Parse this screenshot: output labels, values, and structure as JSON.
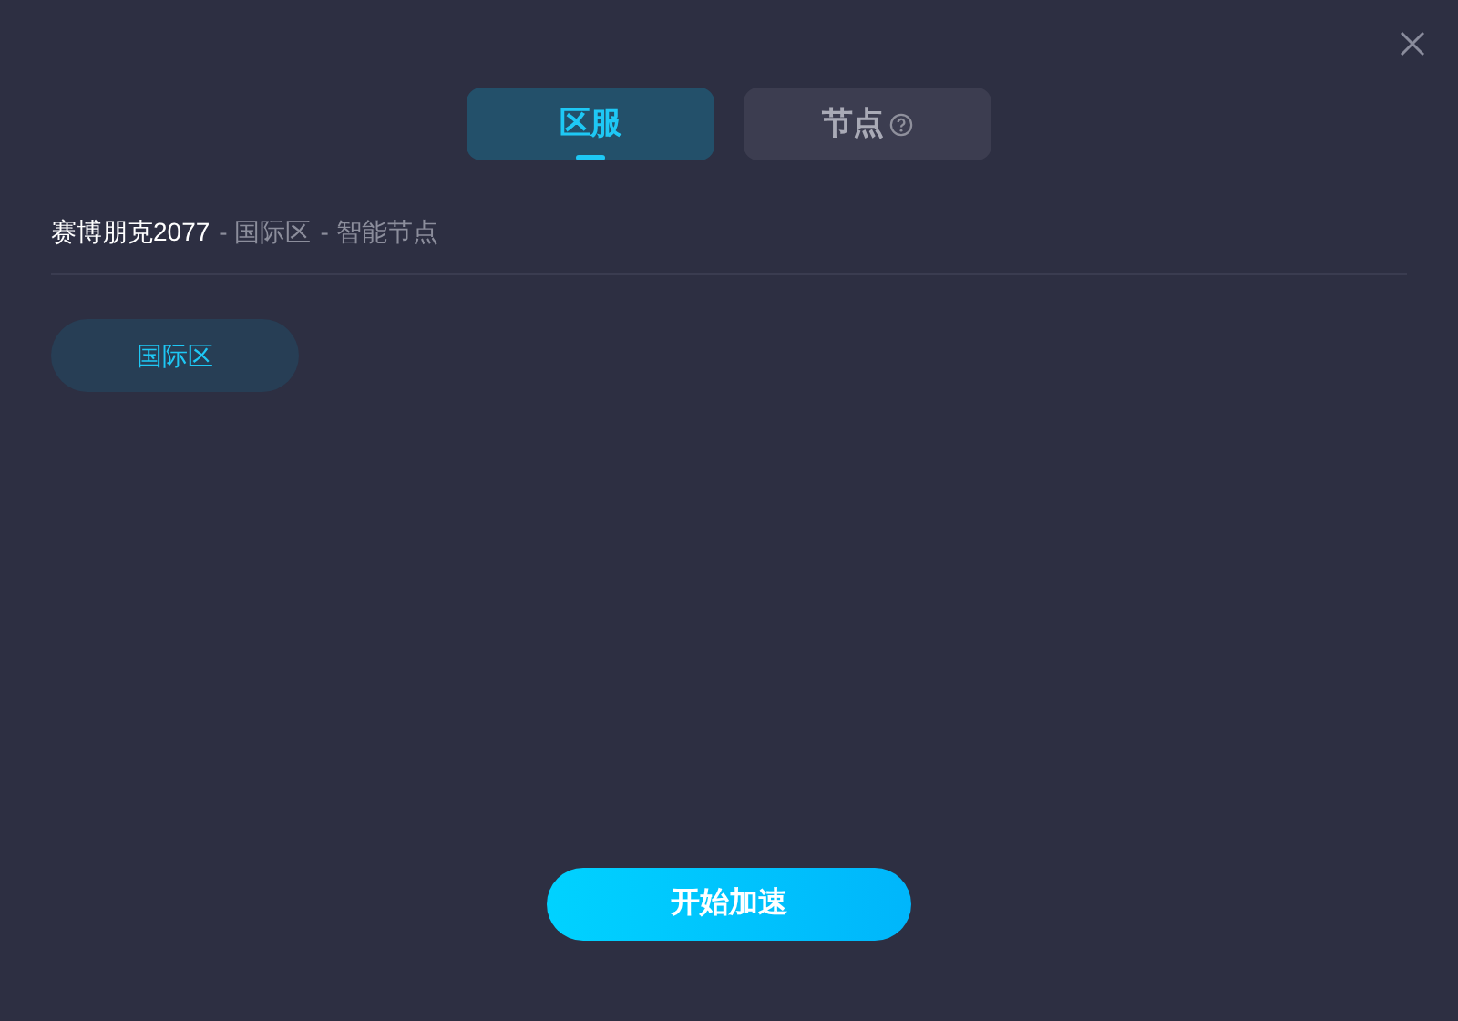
{
  "tabs": [
    {
      "label": "区服",
      "selected": true,
      "help": false
    },
    {
      "label": "节点",
      "selected": false,
      "help": true
    }
  ],
  "breadcrumb": [
    {
      "text": "赛博朋克2077",
      "kind": "title"
    },
    {
      "text": "- 国际区",
      "kind": "crumb"
    },
    {
      "text": "- 智能节点",
      "kind": "crumb"
    }
  ],
  "regions": [
    {
      "label": "国际区",
      "selected": true
    }
  ],
  "start_button": "开始加速"
}
